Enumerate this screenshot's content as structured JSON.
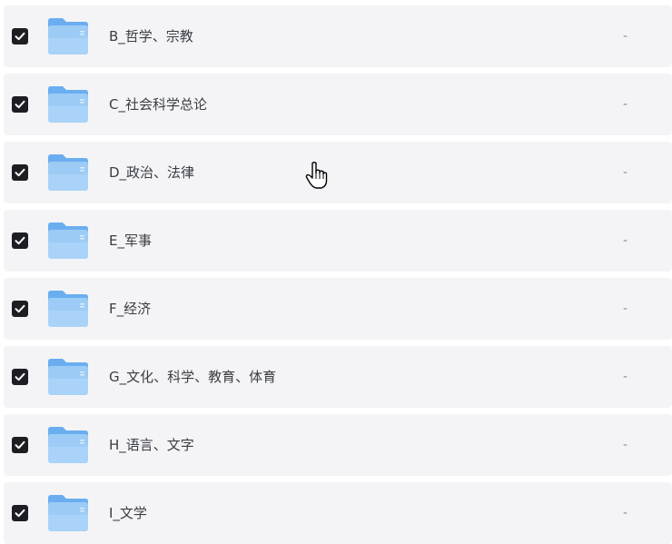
{
  "rows": [
    {
      "name": "B_哲学、宗教",
      "size": "-",
      "checked": true
    },
    {
      "name": "C_社会科学总论",
      "size": "-",
      "checked": true
    },
    {
      "name": "D_政治、法律",
      "size": "-",
      "checked": true
    },
    {
      "name": "E_军事",
      "size": "-",
      "checked": true
    },
    {
      "name": "F_经济",
      "size": "-",
      "checked": true
    },
    {
      "name": "G_文化、科学、教育、体育",
      "size": "-",
      "checked": true
    },
    {
      "name": "H_语言、文字",
      "size": "-",
      "checked": true
    },
    {
      "name": "I_文学",
      "size": "-",
      "checked": true
    }
  ],
  "icons": {
    "row_icon": "folder-icon",
    "checkbox_icon": "checkmark-icon",
    "cursor": "hand-pointer-cursor"
  },
  "colors": {
    "row_bg": "#f4f4f6",
    "checkbox": "#1d1e24",
    "folder_light": "#a9d3f8",
    "folder_dark": "#6aaef0",
    "text": "#3a3d45",
    "muted": "#8a8d95"
  }
}
